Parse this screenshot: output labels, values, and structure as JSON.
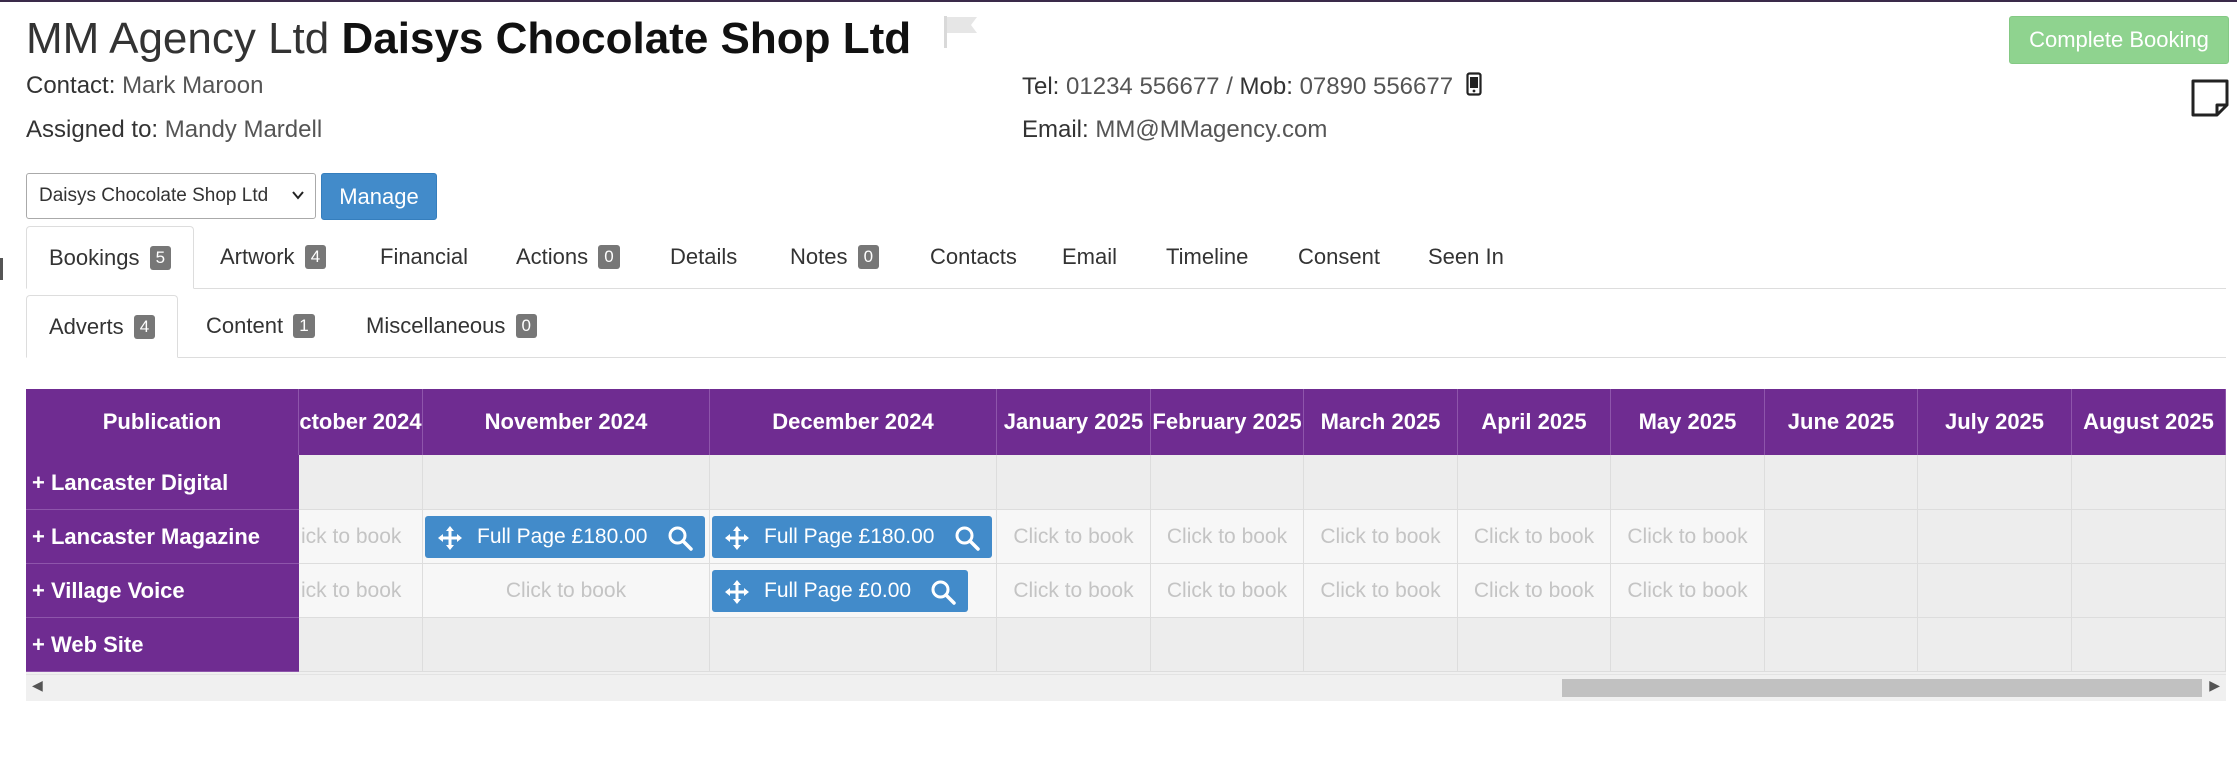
{
  "header": {
    "agency": "MM Agency Ltd",
    "company": "Daisys Chocolate Shop Ltd",
    "contact_label": "Contact:",
    "contact_value": "Mark Maroon",
    "assigned_label": "Assigned to:",
    "assigned_value": "Mandy Mardell",
    "tel_label": "Tel:",
    "tel_value": "01234 556677",
    "mob_sep": " / ",
    "mob_label": "Mob:",
    "mob_value": "07890 556677",
    "email_label": "Email:",
    "email_value": "MM@MMagency.com",
    "complete_button": "Complete Booking",
    "icons": [
      "flag-icon",
      "phone-icon",
      "sticky-note-icon"
    ]
  },
  "account": {
    "selected": "Daisys Chocolate Shop Ltd",
    "manage_button": "Manage"
  },
  "main_tabs": [
    {
      "label": "Bookings",
      "badge": "5",
      "active": true
    },
    {
      "label": "Artwork",
      "badge": "4"
    },
    {
      "label": "Financial"
    },
    {
      "label": "Actions",
      "badge": "0"
    },
    {
      "label": "Details"
    },
    {
      "label": "Notes",
      "badge": "0"
    },
    {
      "label": "Contacts"
    },
    {
      "label": "Email"
    },
    {
      "label": "Timeline"
    },
    {
      "label": "Consent"
    },
    {
      "label": "Seen In"
    }
  ],
  "sub_tabs": [
    {
      "label": "Adverts",
      "badge": "4",
      "active": true
    },
    {
      "label": "Content",
      "badge": "1"
    },
    {
      "label": "Miscellaneous",
      "badge": "0"
    }
  ],
  "grid": {
    "publication_header": "Publication",
    "months": [
      "ctober 2024",
      "November 2024",
      "December 2024",
      "January 2025",
      "February 2025",
      "March 2025",
      "April 2025",
      "May 2025",
      "June 2025",
      "July 2025",
      "August 2025"
    ],
    "click_to_book": "Click to book",
    "click_to_book_clipped": "ick to book",
    "rows": [
      {
        "name": "+ Lancaster Digital"
      },
      {
        "name": "+ Lancaster Magazine"
      },
      {
        "name": "+ Village Voice"
      },
      {
        "name": "+ Web Site"
      }
    ],
    "bookings": [
      {
        "label": "Full Page £180.00"
      },
      {
        "label": "Full Page £180.00"
      },
      {
        "label": "Full Page £0.00"
      }
    ]
  },
  "colors": {
    "accent_purple": "#6f2c91",
    "primary_blue": "#428bca",
    "success_green": "#8fd38f"
  }
}
